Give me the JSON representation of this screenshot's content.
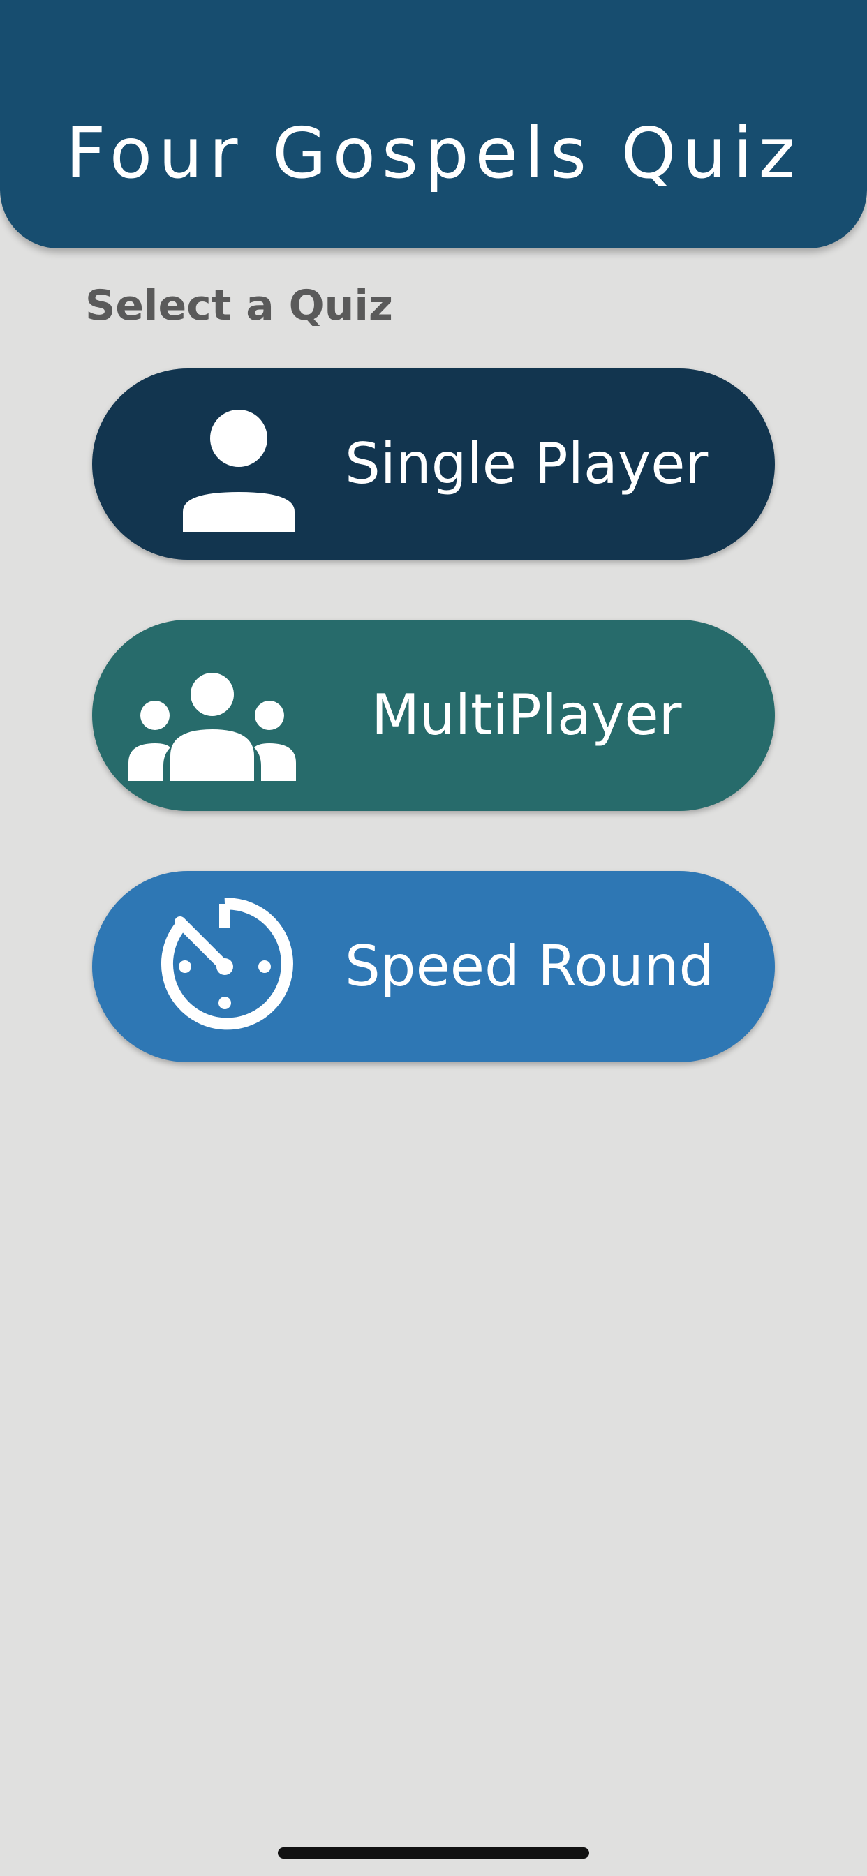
{
  "header": {
    "title": "Four Gospels Quiz",
    "color": "#174d6f"
  },
  "main": {
    "section_label": "Select a Quiz",
    "quiz_options": [
      {
        "label": "Single Player",
        "icon": "person-icon",
        "color": "#12354f"
      },
      {
        "label": "MultiPlayer",
        "icon": "group-icon",
        "color": "#276b6b"
      },
      {
        "label": "Speed Round",
        "icon": "timer-icon",
        "color": "#2e77b4"
      }
    ]
  },
  "colors": {
    "background": "#e0e0df",
    "text_on_button": "#ffffff",
    "section_label": "#5a5a5a"
  }
}
